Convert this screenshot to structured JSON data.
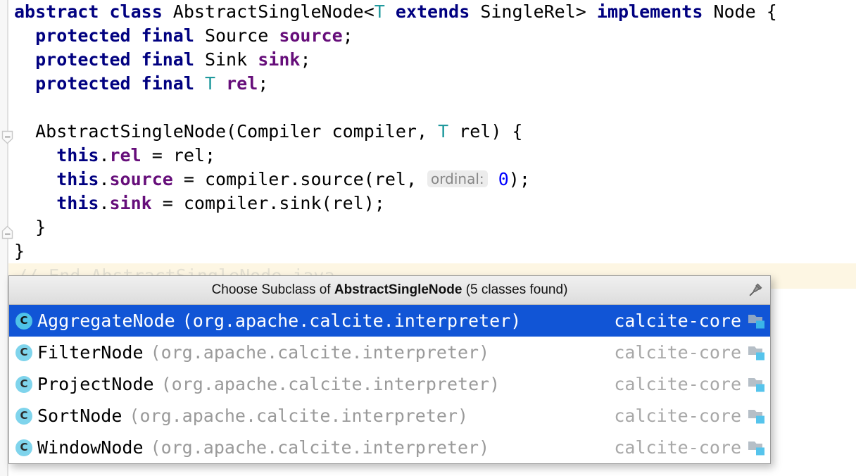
{
  "editor": {
    "background_color": "#ffffff",
    "caret_line_color": "#fdf6e3",
    "ghost_comment": "// End AbstractSingleNode.java",
    "gutter": {
      "fold_collapse_icon": "fold-collapse-icon",
      "fold_end_icon": "fold-end-icon"
    },
    "lines": [
      {
        "id": "line-class-decl",
        "tokens": [
          {
            "t": "abstract",
            "c": "kw"
          },
          {
            "t": " ",
            "c": "plain"
          },
          {
            "t": "class",
            "c": "kw"
          },
          {
            "t": " AbstractSingleNode<",
            "c": "plain"
          },
          {
            "t": "T",
            "c": "typar"
          },
          {
            "t": " ",
            "c": "plain"
          },
          {
            "t": "extends",
            "c": "kw"
          },
          {
            "t": " SingleRel> ",
            "c": "plain"
          },
          {
            "t": "implements",
            "c": "kw"
          },
          {
            "t": " Node {",
            "c": "plain"
          }
        ]
      },
      {
        "id": "line-field-source",
        "tokens": [
          {
            "t": "  ",
            "c": "plain"
          },
          {
            "t": "protected",
            "c": "kw"
          },
          {
            "t": " ",
            "c": "plain"
          },
          {
            "t": "final",
            "c": "kw"
          },
          {
            "t": " Source ",
            "c": "plain"
          },
          {
            "t": "source",
            "c": "fld"
          },
          {
            "t": ";",
            "c": "plain"
          }
        ]
      },
      {
        "id": "line-field-sink",
        "tokens": [
          {
            "t": "  ",
            "c": "plain"
          },
          {
            "t": "protected",
            "c": "kw"
          },
          {
            "t": " ",
            "c": "plain"
          },
          {
            "t": "final",
            "c": "kw"
          },
          {
            "t": " Sink ",
            "c": "plain"
          },
          {
            "t": "sink",
            "c": "fld"
          },
          {
            "t": ";",
            "c": "plain"
          }
        ]
      },
      {
        "id": "line-field-rel",
        "tokens": [
          {
            "t": "  ",
            "c": "plain"
          },
          {
            "t": "protected",
            "c": "kw"
          },
          {
            "t": " ",
            "c": "plain"
          },
          {
            "t": "final",
            "c": "kw"
          },
          {
            "t": " ",
            "c": "plain"
          },
          {
            "t": "T",
            "c": "typar"
          },
          {
            "t": " ",
            "c": "plain"
          },
          {
            "t": "rel",
            "c": "fld"
          },
          {
            "t": ";",
            "c": "plain"
          }
        ]
      },
      {
        "id": "line-blank-1",
        "tokens": [
          {
            "t": " ",
            "c": "plain"
          }
        ]
      },
      {
        "id": "line-ctor",
        "tokens": [
          {
            "t": "  AbstractSingleNode(Compiler compiler, ",
            "c": "plain"
          },
          {
            "t": "T",
            "c": "typar"
          },
          {
            "t": " rel) {",
            "c": "plain"
          }
        ]
      },
      {
        "id": "line-assign-rel",
        "tokens": [
          {
            "t": "    ",
            "c": "plain"
          },
          {
            "t": "this",
            "c": "kw"
          },
          {
            "t": ".",
            "c": "plain"
          },
          {
            "t": "rel",
            "c": "fld"
          },
          {
            "t": " = rel;",
            "c": "plain"
          }
        ]
      },
      {
        "id": "line-assign-source",
        "tokens": [
          {
            "t": "    ",
            "c": "plain"
          },
          {
            "t": "this",
            "c": "kw"
          },
          {
            "t": ".",
            "c": "plain"
          },
          {
            "t": "source",
            "c": "fld"
          },
          {
            "t": " = compiler.source(rel, ",
            "c": "plain"
          },
          {
            "t": "ordinal:",
            "c": "inlay"
          },
          {
            "t": " ",
            "c": "plain"
          },
          {
            "t": "0",
            "c": "num"
          },
          {
            "t": ");",
            "c": "plain"
          }
        ]
      },
      {
        "id": "line-assign-sink",
        "tokens": [
          {
            "t": "    ",
            "c": "plain"
          },
          {
            "t": "this",
            "c": "kw"
          },
          {
            "t": ".",
            "c": "plain"
          },
          {
            "t": "sink",
            "c": "fld"
          },
          {
            "t": " = compiler.sink(rel);",
            "c": "plain"
          }
        ]
      },
      {
        "id": "line-close-ctor",
        "tokens": [
          {
            "t": "  }",
            "c": "plain"
          }
        ]
      },
      {
        "id": "line-close-class",
        "tokens": [
          {
            "t": "}",
            "c": "plain"
          }
        ]
      }
    ]
  },
  "popup": {
    "title_prefix": "Choose Subclass of ",
    "title_target": "AbstractSingleNode",
    "title_suffix": " (5 classes found)",
    "pin_icon": "pin-icon",
    "selected_index": 0,
    "selected_bg_color": "#1155d6",
    "items": [
      {
        "name": "AggregateNode",
        "package": "(org.apache.calcite.interpreter)",
        "module": "calcite-core",
        "icon": "class-icon",
        "module_icon": "module-folder-icon",
        "selected": true
      },
      {
        "name": "FilterNode",
        "package": "(org.apache.calcite.interpreter)",
        "module": "calcite-core",
        "icon": "class-icon",
        "module_icon": "module-folder-icon",
        "selected": false
      },
      {
        "name": "ProjectNode",
        "package": "(org.apache.calcite.interpreter)",
        "module": "calcite-core",
        "icon": "class-icon",
        "module_icon": "module-folder-icon",
        "selected": false
      },
      {
        "name": "SortNode",
        "package": "(org.apache.calcite.interpreter)",
        "module": "calcite-core",
        "icon": "class-icon",
        "module_icon": "module-folder-icon",
        "selected": false
      },
      {
        "name": "WindowNode",
        "package": "(org.apache.calcite.interpreter)",
        "module": "calcite-core",
        "icon": "class-icon",
        "module_icon": "module-folder-icon",
        "selected": false
      }
    ],
    "class_icon_letter": "C"
  }
}
